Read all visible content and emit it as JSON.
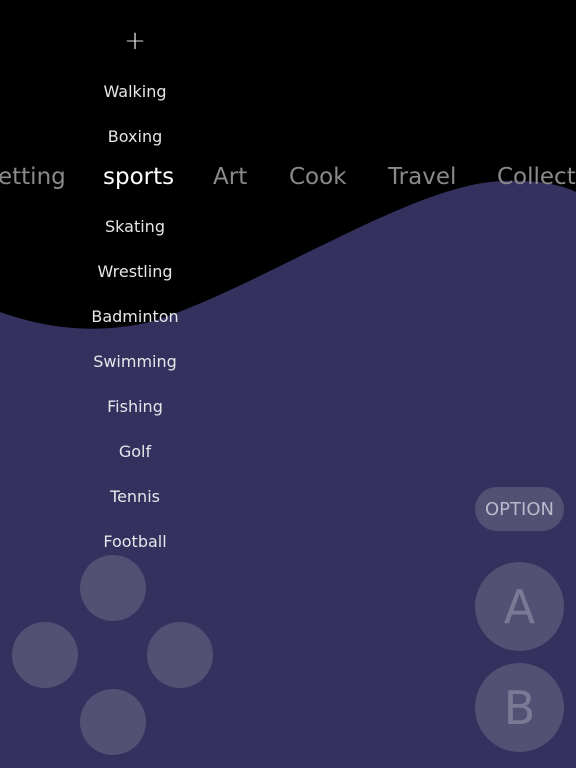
{
  "colors": {
    "background_top": "#000000",
    "wave": "#34315f"
  },
  "add_icon": "+",
  "categories": [
    {
      "label": "etting"
    },
    {
      "label": "sports",
      "active": true
    },
    {
      "label": "Art"
    },
    {
      "label": "Cook"
    },
    {
      "label": "Travel"
    },
    {
      "label": "Collectin"
    }
  ],
  "subcategories": [
    "Walking",
    "Boxing",
    "Skating",
    "Wrestling",
    "Badminton",
    "Swimming",
    "Fishing",
    "Golf",
    "Tennis",
    "Football"
  ],
  "controls": {
    "option": "OPTION",
    "a": "A",
    "b": "B"
  }
}
